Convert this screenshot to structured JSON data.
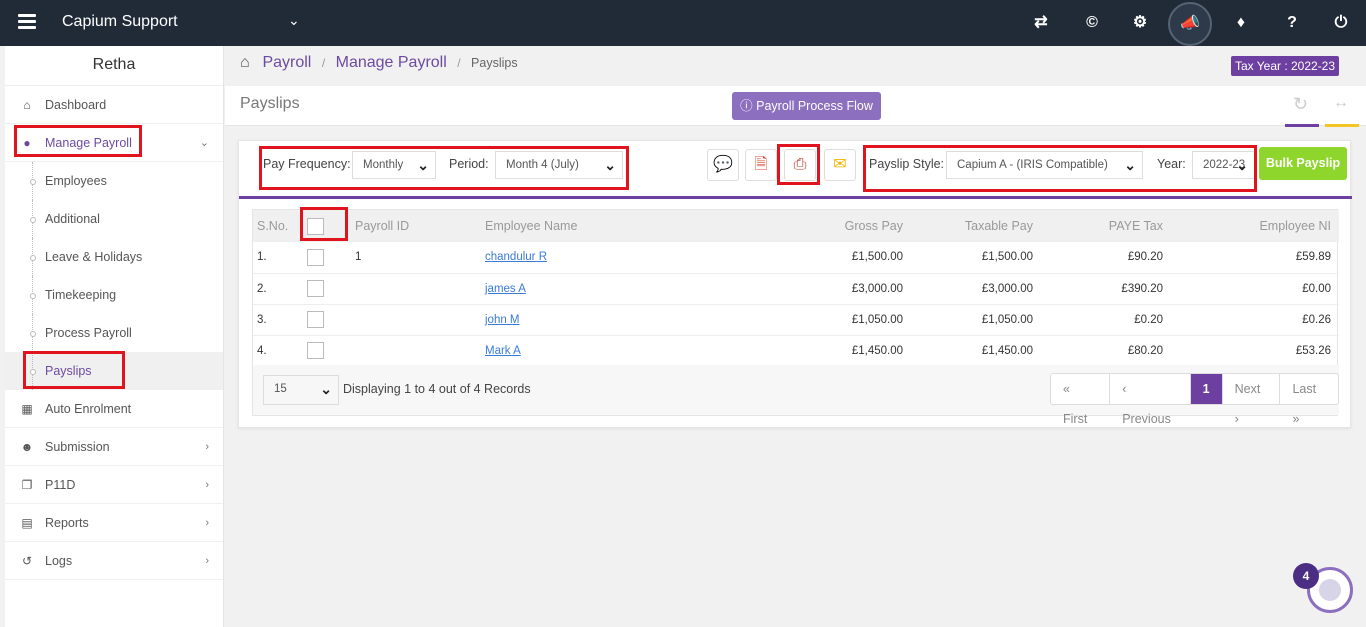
{
  "topbar": {
    "app_title": "Capium Support",
    "icons": [
      "transfer-icon",
      "capium-icon",
      "apps-icon",
      "announcement-icon",
      "ticket-icon",
      "help-icon",
      "power-icon"
    ]
  },
  "sidebar": {
    "user_name": "Retha",
    "items": [
      {
        "label": "Dashboard",
        "icon": "home-icon"
      },
      {
        "label": "Manage Payroll",
        "icon": "user-icon"
      },
      {
        "label": "Auto Enrolment",
        "icon": "grid-icon"
      },
      {
        "label": "Submission",
        "icon": "users-icon"
      },
      {
        "label": "P11D",
        "icon": "copy-icon"
      },
      {
        "label": "Reports",
        "icon": "report-icon"
      },
      {
        "label": "Logs",
        "icon": "history-icon"
      }
    ],
    "sub_items": [
      "Employees",
      "Additional",
      "Leave & Holidays",
      "Timekeeping",
      "Process Payroll",
      "Payslips"
    ]
  },
  "breadcrumb": {
    "items": [
      "Payroll",
      "Manage Payroll"
    ],
    "current": "Payslips"
  },
  "tax_year": "Tax Year : 2022-23",
  "page_title": "Payslips",
  "flow_button": "Payroll Process Flow",
  "filters": {
    "pay_frequency_label": "Pay Frequency:",
    "pay_frequency_value": "Monthly",
    "period_label": "Period:",
    "period_value": "Month 4 (July)",
    "payslip_style_label": "Payslip Style:",
    "payslip_style_value": "Capium A - (IRIS Compatible)",
    "year_label": "Year:",
    "year_value": "2022-23"
  },
  "bulk_button": "Bulk Payslip",
  "table": {
    "headers": [
      "S.No.",
      "",
      "Payroll ID",
      "Employee Name",
      "Gross Pay",
      "Taxable Pay",
      "PAYE Tax",
      "Employee NI"
    ],
    "rows": [
      {
        "sno": "1.",
        "payroll_id": "1",
        "name": "chandulur R",
        "gross": "£1,500.00",
        "taxable": "£1,500.00",
        "paye": "£90.20",
        "ni": "£59.89"
      },
      {
        "sno": "2.",
        "payroll_id": "",
        "name": "james A",
        "gross": "£3,000.00",
        "taxable": "£3,000.00",
        "paye": "£390.20",
        "ni": "£0.00"
      },
      {
        "sno": "3.",
        "payroll_id": "",
        "name": "john M",
        "gross": "£1,050.00",
        "taxable": "£1,050.00",
        "paye": "£0.20",
        "ni": "£0.26"
      },
      {
        "sno": "4.",
        "payroll_id": "",
        "name": "Mark A",
        "gross": "£1,450.00",
        "taxable": "£1,450.00",
        "paye": "£80.20",
        "ni": "£53.26"
      }
    ]
  },
  "pagination": {
    "page_size": "15",
    "info": "Displaying 1 to 4 out of 4 Records",
    "first": "« First",
    "previous": "‹ Previous",
    "current": "1",
    "next": "Next ›",
    "last": "Last »"
  },
  "chat_badge": "4",
  "colors": {
    "topbar": "#212b38",
    "accent": "#6c3fa0",
    "bulk": "#8ed62c",
    "annotation": "#e0141e"
  }
}
